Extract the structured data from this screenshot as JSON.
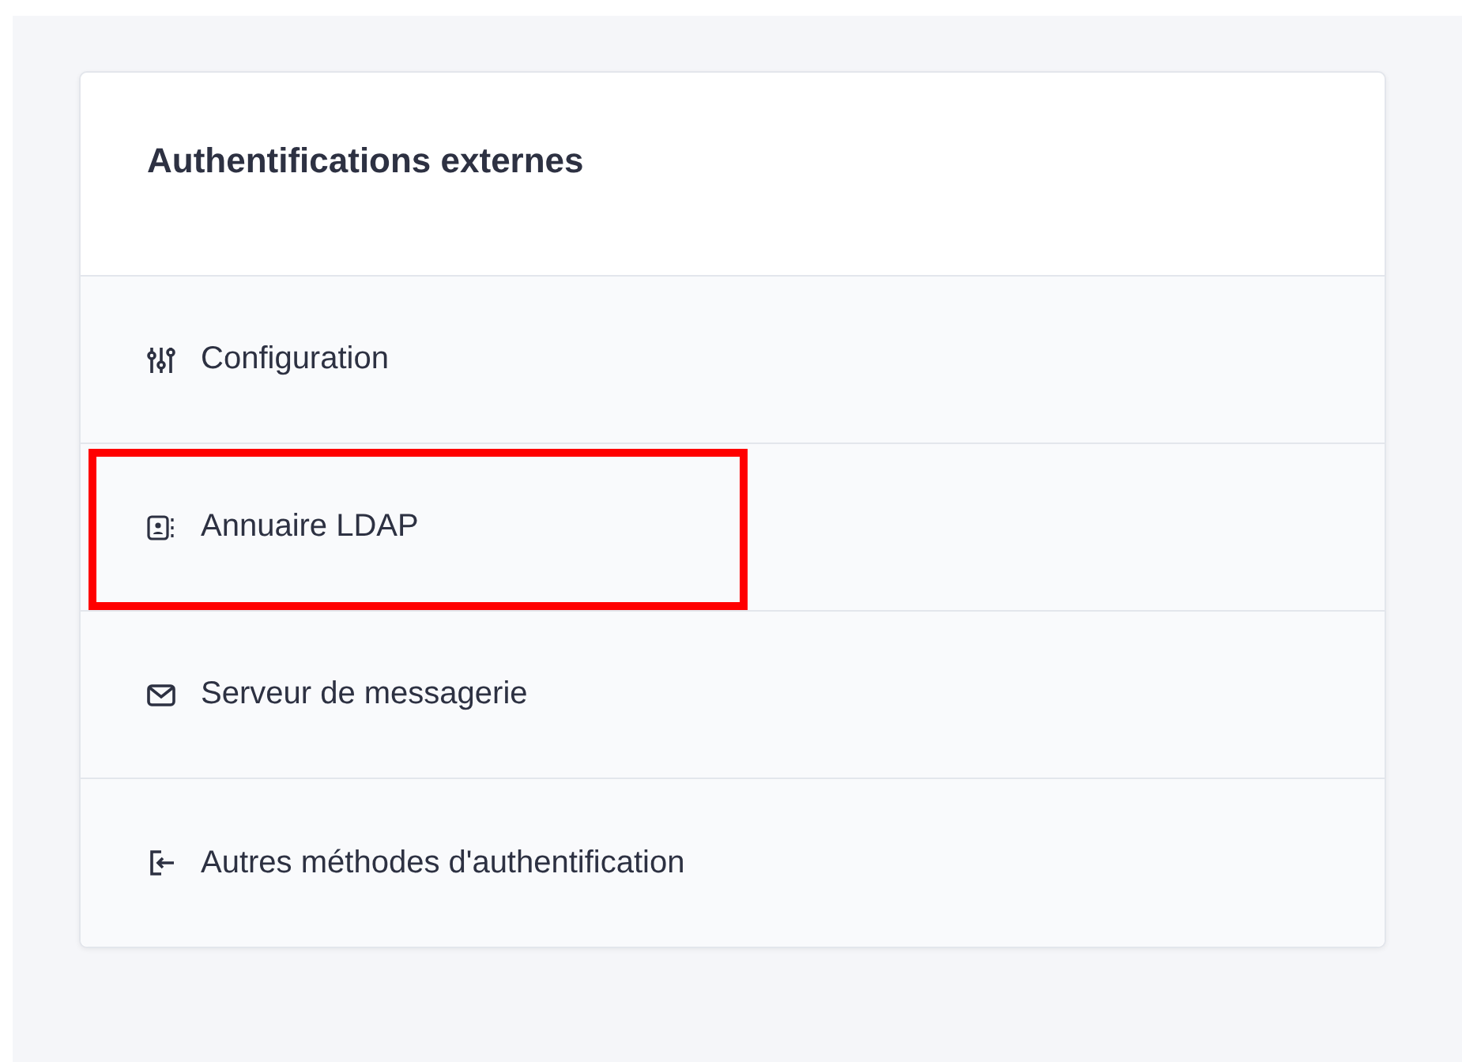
{
  "card": {
    "title": "Authentifications externes",
    "items": [
      {
        "label": "Configuration",
        "highlighted": false
      },
      {
        "label": "Annuaire LDAP",
        "highlighted": true
      },
      {
        "label": "Serveur de messagerie",
        "highlighted": false
      },
      {
        "label": "Autres méthodes d'authentification",
        "highlighted": false
      }
    ]
  }
}
